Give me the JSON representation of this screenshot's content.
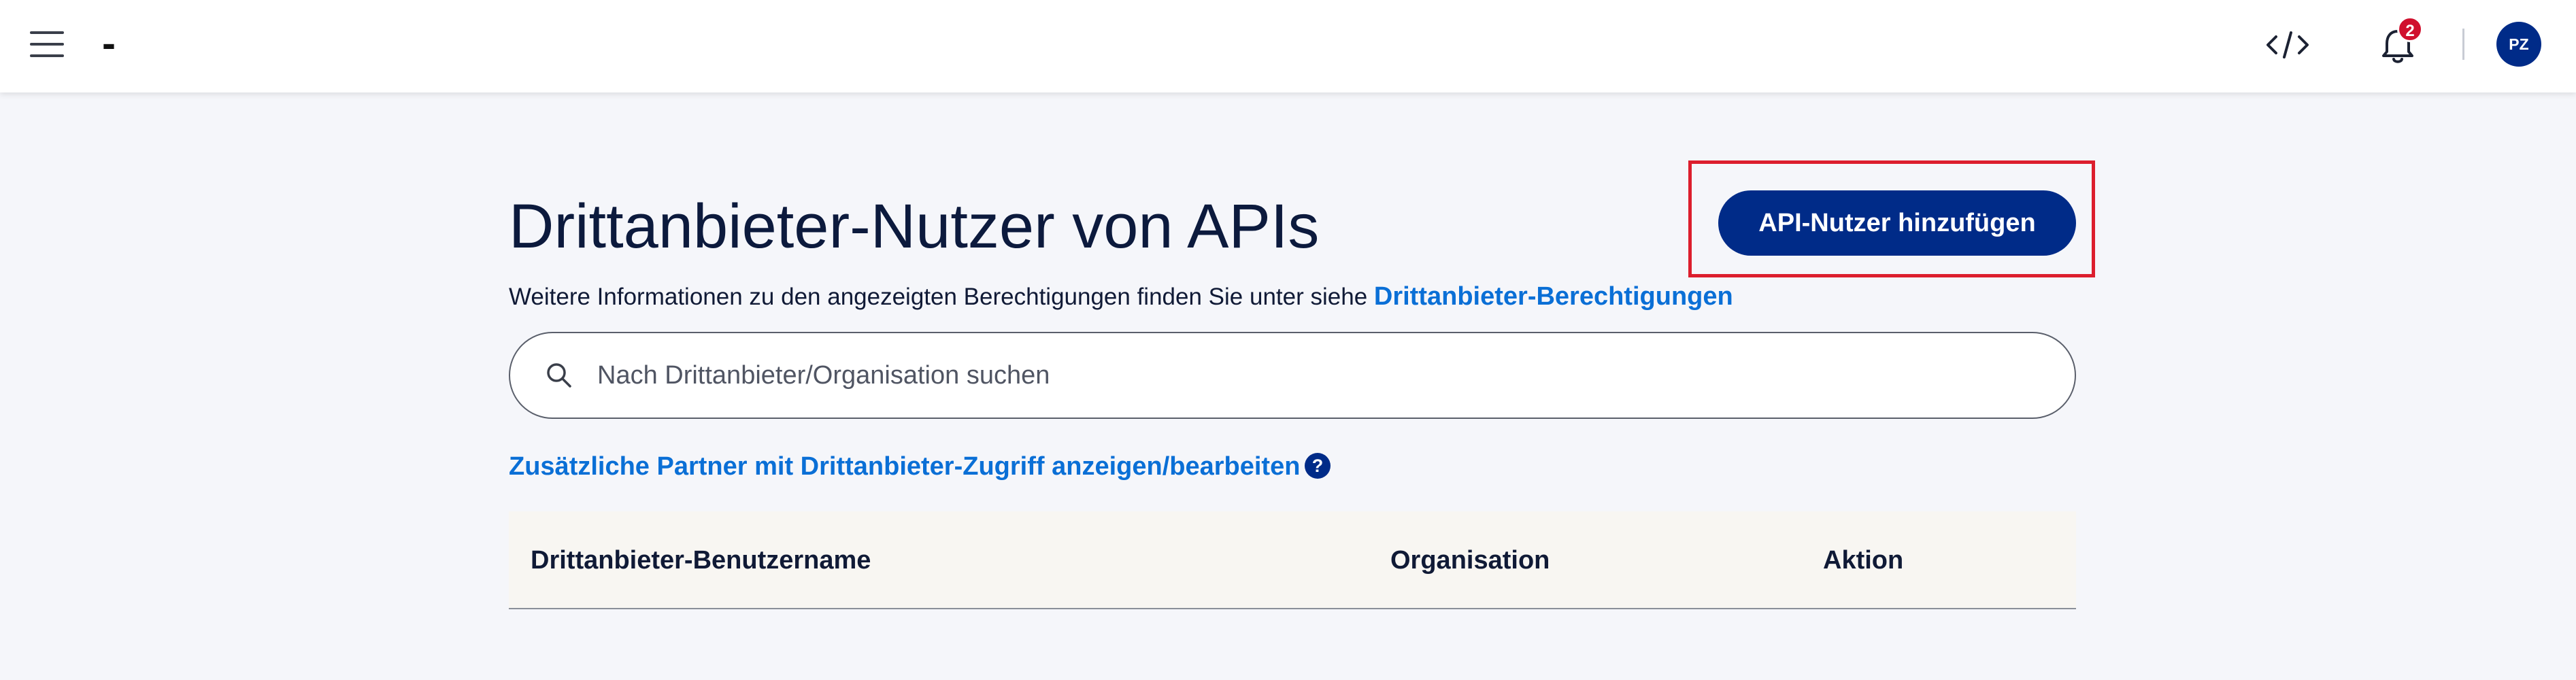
{
  "header": {
    "app_title": "-",
    "notification_count": "2",
    "user_initials": "PZ",
    "icons": {
      "menu": "hamburger-menu-icon",
      "code": "code-icon",
      "notifications": "bell-icon"
    }
  },
  "page": {
    "title": "Drittanbieter-Nutzer von APIs",
    "info_text": "Weitere Informationen zu den angezeigten Berechtigungen finden Sie unter siehe ",
    "info_link": "Drittanbieter-Berechtigungen",
    "add_button_label": "API-Nutzer hinzufügen",
    "search": {
      "placeholder": "Nach Drittanbieter/Organisation suchen",
      "value": ""
    },
    "partner_link": "Zusätzliche Partner mit Drittanbieter-Zugriff anzeigen/bearbeiten",
    "help_icon_label": "?"
  },
  "table": {
    "columns": [
      "Drittanbieter-Benutzername",
      "Organisation",
      "Aktion"
    ],
    "rows": []
  },
  "colors": {
    "primary": "#002b88",
    "link": "#0a6fd6",
    "badge": "#d0102e",
    "highlight": "#dc1e2d",
    "background": "#f5f6fa"
  }
}
